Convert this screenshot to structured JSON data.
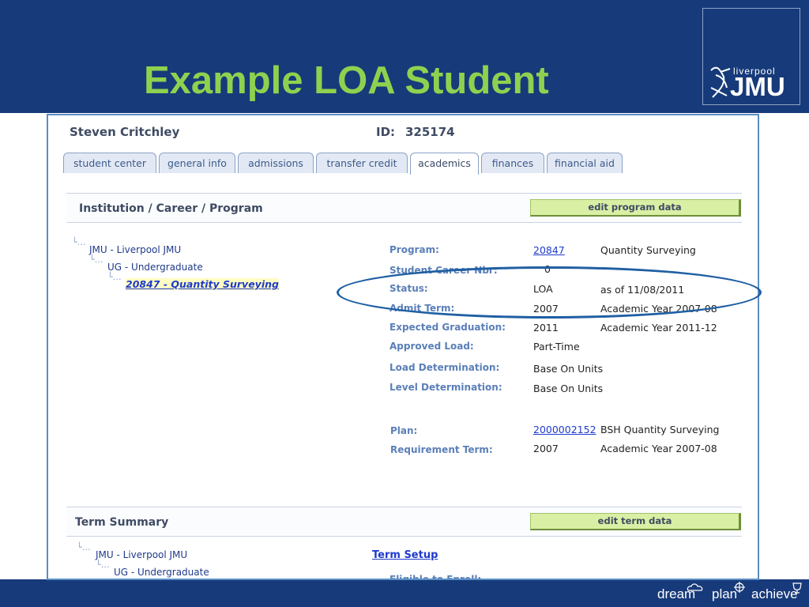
{
  "slide": {
    "title": "Example LOA Student",
    "logo": {
      "small_text": "liverpool",
      "big_text": "JMU"
    },
    "footer": {
      "word1": "dream",
      "word2": "plan",
      "word3": "achieve"
    }
  },
  "student": {
    "name": "Steven Critchley",
    "id_label": "ID:",
    "id_value": "325174"
  },
  "tabs": [
    {
      "label": "student center"
    },
    {
      "label": "general info"
    },
    {
      "label": "admissions"
    },
    {
      "label": "transfer credit"
    },
    {
      "label": "academics"
    },
    {
      "label": "finances"
    },
    {
      "label": "financial aid"
    }
  ],
  "institution_section": {
    "title": "Institution / Career / Program",
    "button": "edit program data",
    "tree": {
      "item1": "JMU - Liverpool JMU",
      "item2": "UG - Undergraduate",
      "item3": "20847 - Quantity Surveying"
    },
    "fields": [
      {
        "label": "Program:",
        "value": "20847",
        "extra": "Quantity Surveying"
      },
      {
        "label": "Student Career Nbr:",
        "value": "0",
        "extra": ""
      },
      {
        "label": "Status:",
        "value": "LOA",
        "extra": "as of 11/08/2011"
      },
      {
        "label": "Admit Term:",
        "value": "2007",
        "extra": "Academic Year 2007-08"
      },
      {
        "label": "Expected Graduation:",
        "value": "2011",
        "extra": "Academic Year 2011-12"
      },
      {
        "label": "Approved Load:",
        "value": "Part-Time",
        "extra": ""
      },
      {
        "label": "Load Determination:",
        "value": "Base On Units",
        "extra": ""
      },
      {
        "label": "Level Determination:",
        "value": "Base On Units",
        "extra": ""
      },
      {
        "label": "Plan:",
        "value": "2000002152",
        "extra": "BSH Quantity Surveying"
      },
      {
        "label": "Requirement Term:",
        "value": "2007",
        "extra": "Academic Year 2007-08"
      }
    ]
  },
  "term_section": {
    "title": "Term Summary",
    "button": "edit term data",
    "tree": {
      "item1": "JMU - Liverpool JMU",
      "item2": "UG - Undergraduate"
    },
    "term_setup": "Term Setup",
    "eligible_label": "Eligible to Enroll:"
  },
  "colors": {
    "header_band": "#173a7a",
    "title_green": "#8fd14f",
    "highlight_ellipse": "#1f5fa3",
    "button_green": "#d9efa4"
  }
}
